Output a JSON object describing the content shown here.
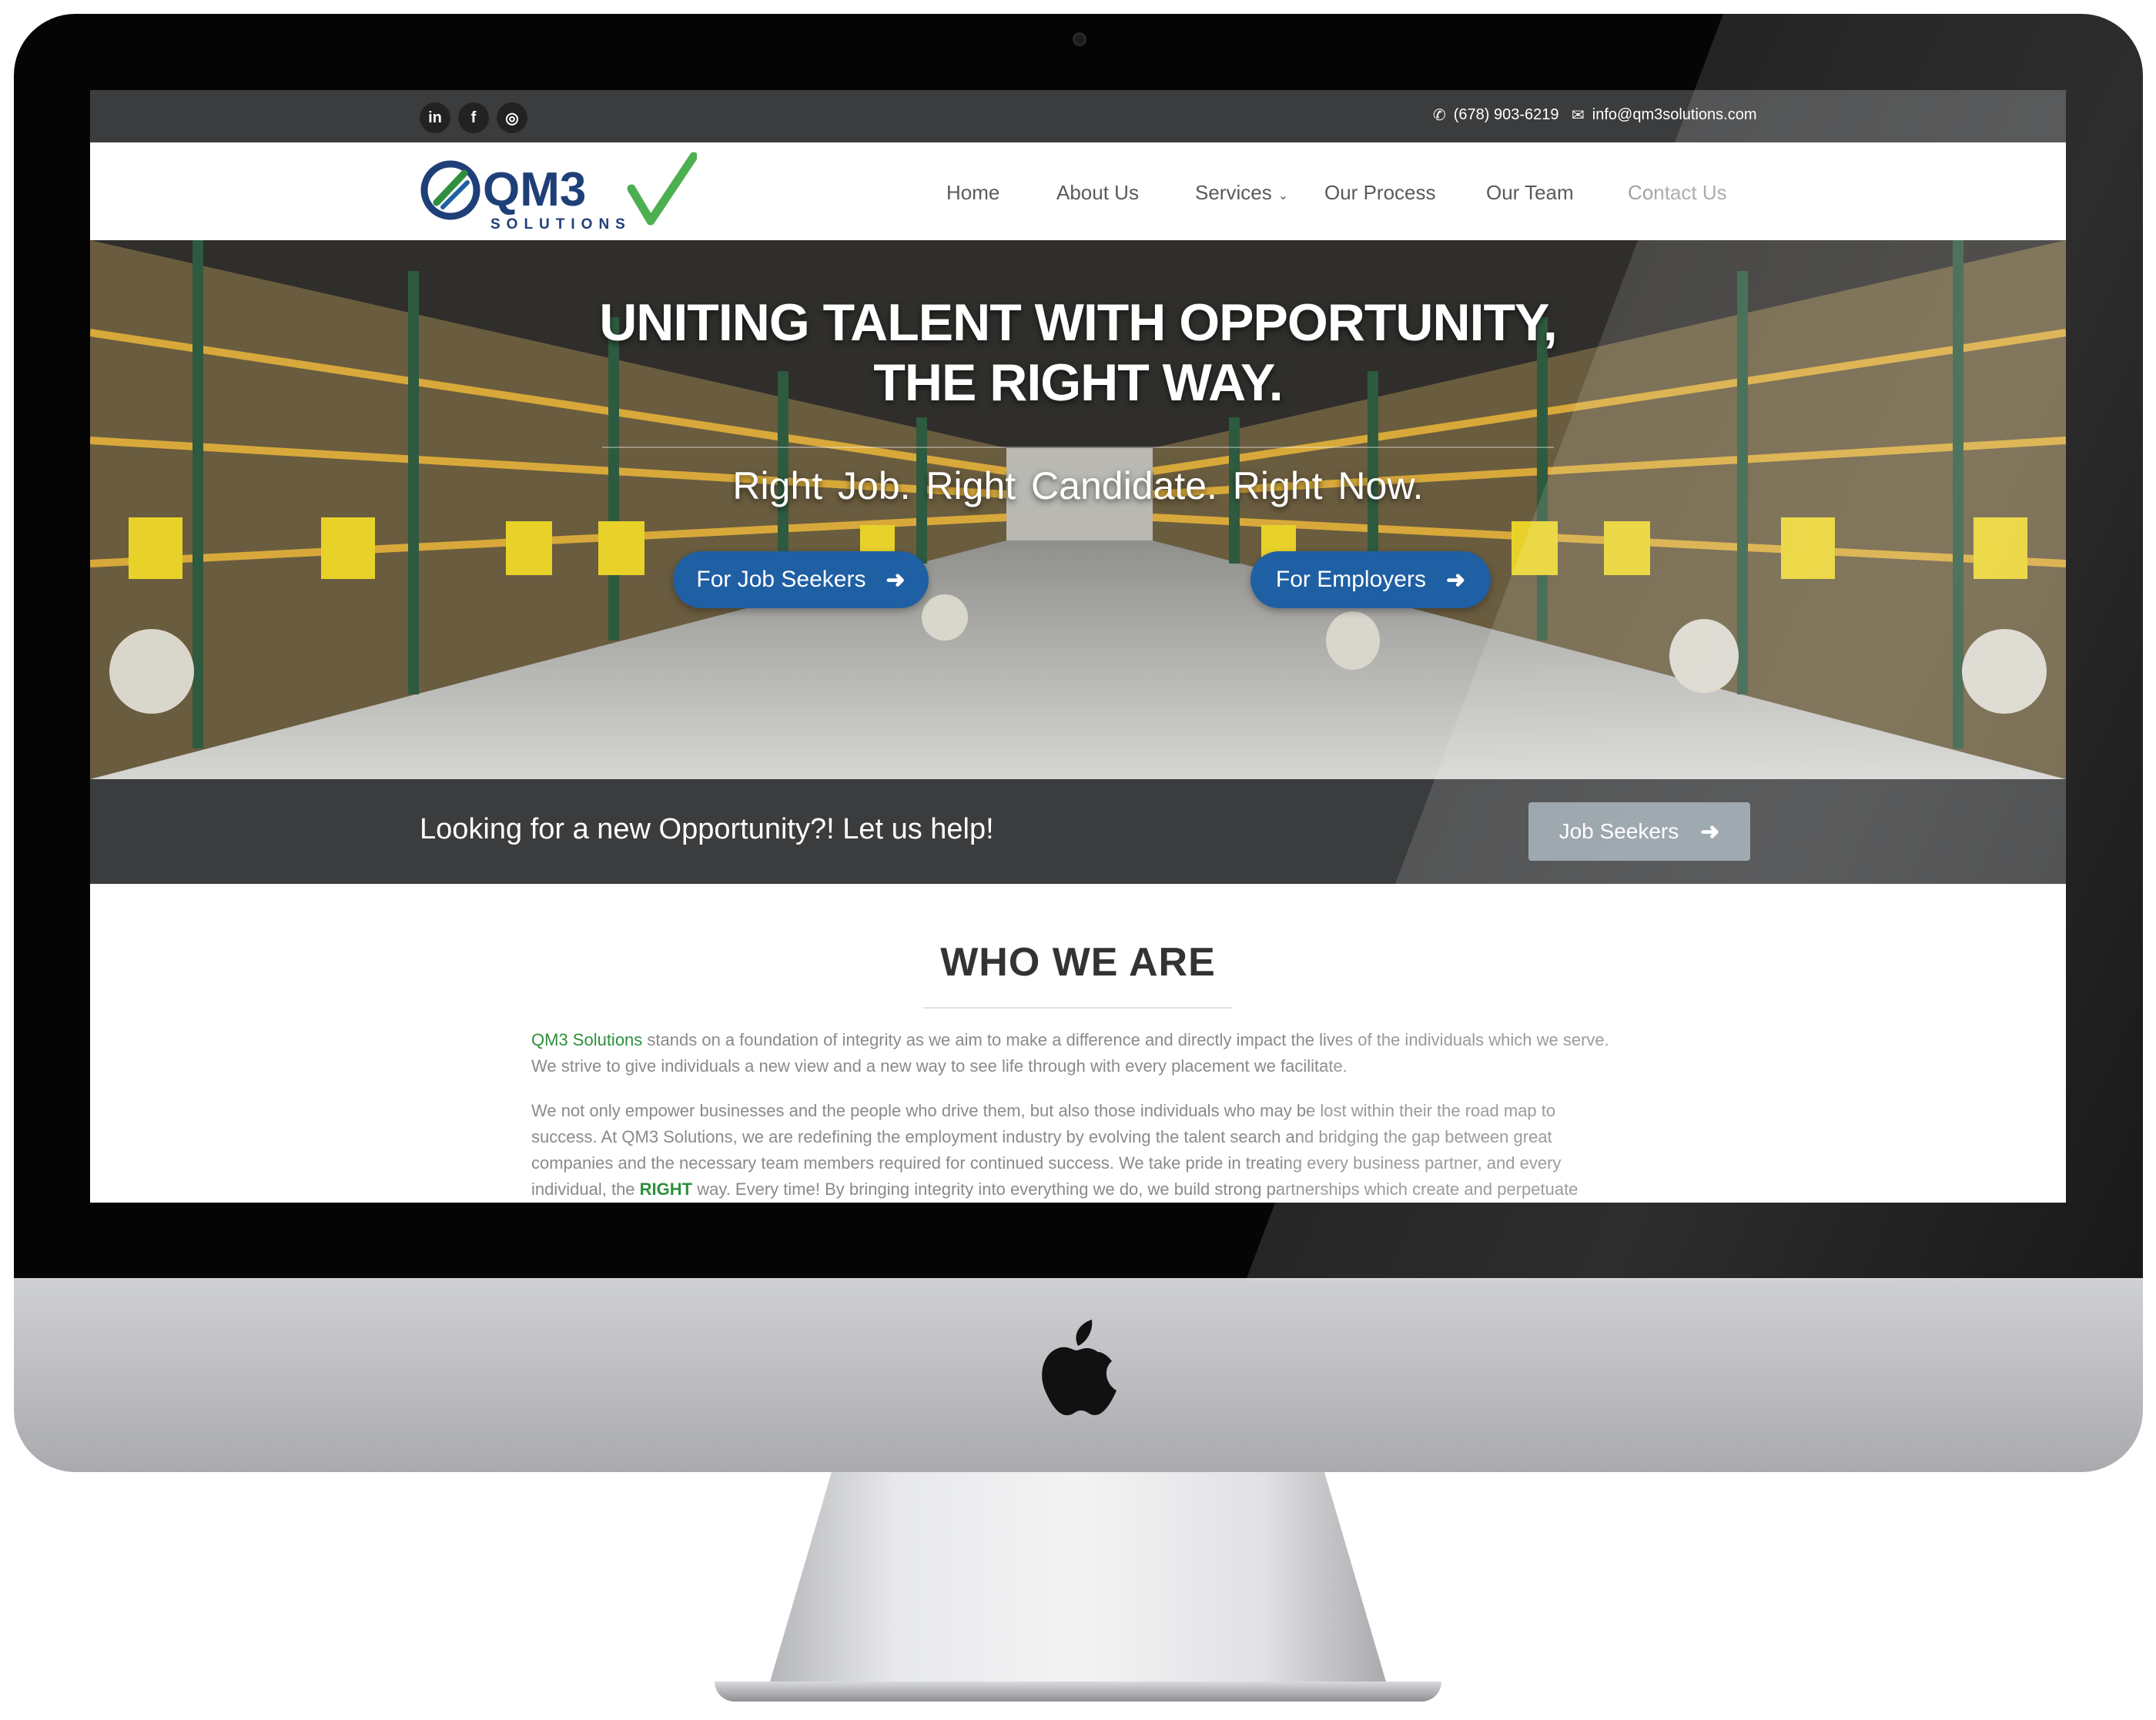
{
  "topbar": {
    "social": [
      {
        "name": "linkedin",
        "glyph": "in"
      },
      {
        "name": "facebook",
        "glyph": "f"
      },
      {
        "name": "instagram",
        "glyph": "◎"
      }
    ],
    "phone": "(678) 903-6219",
    "email": "info@qm3solutions.com"
  },
  "logo": {
    "text": "QM3",
    "tagline": "SOLUTIONS"
  },
  "nav": {
    "items": [
      {
        "label": "Home"
      },
      {
        "label": "About Us"
      },
      {
        "label": "Services"
      },
      {
        "label": "Our Process"
      },
      {
        "label": "Our Team"
      },
      {
        "label": "Contact Us"
      }
    ],
    "services_caret": "⌄"
  },
  "hero": {
    "title_line1": "UNITING TALENT WITH OPPORTUNITY,",
    "title_line2": "THE RIGHT WAY.",
    "subtitle": "Right Job.  Right Candidate.  Right Now.",
    "buttons": [
      {
        "label": "For Job Seekers",
        "icon": "arrow-right-icon"
      },
      {
        "label": "For Employers",
        "icon": "arrow-right-icon"
      }
    ]
  },
  "cta": {
    "text": "Looking for a new Opportunity?! Let us help!",
    "button": "Job Seekers"
  },
  "who": {
    "title": "WHO WE ARE",
    "p1_brand": "QM3 Solutions",
    "p1_rest": " stands on a foundation of integrity as we aim to make a difference and directly impact the lives of the individuals which we serve. We strive to give individuals a new view and a new way to see life through with every placement we facilitate.",
    "p2_start": "We not only empower businesses and the people who drive them, but also those individuals who may be lost within their the road map to success. At QM3 Solutions, we are redefining the employment industry by evolving the talent search and bridging the gap between great companies and the necessary team members required for continued success. We take pride in treating every business partner, and every individual, the ",
    "p2_emph": "RIGHT",
    "p2_end": " way. Every time! By bringing integrity into everything we do, we build strong partnerships which create and perpetuate"
  },
  "colors": {
    "brand_blue": "#1f5fa3",
    "brand_green": "#2f8f3e",
    "bar_dark": "#3b3c3d",
    "cta_button": "#8d9aa2"
  }
}
